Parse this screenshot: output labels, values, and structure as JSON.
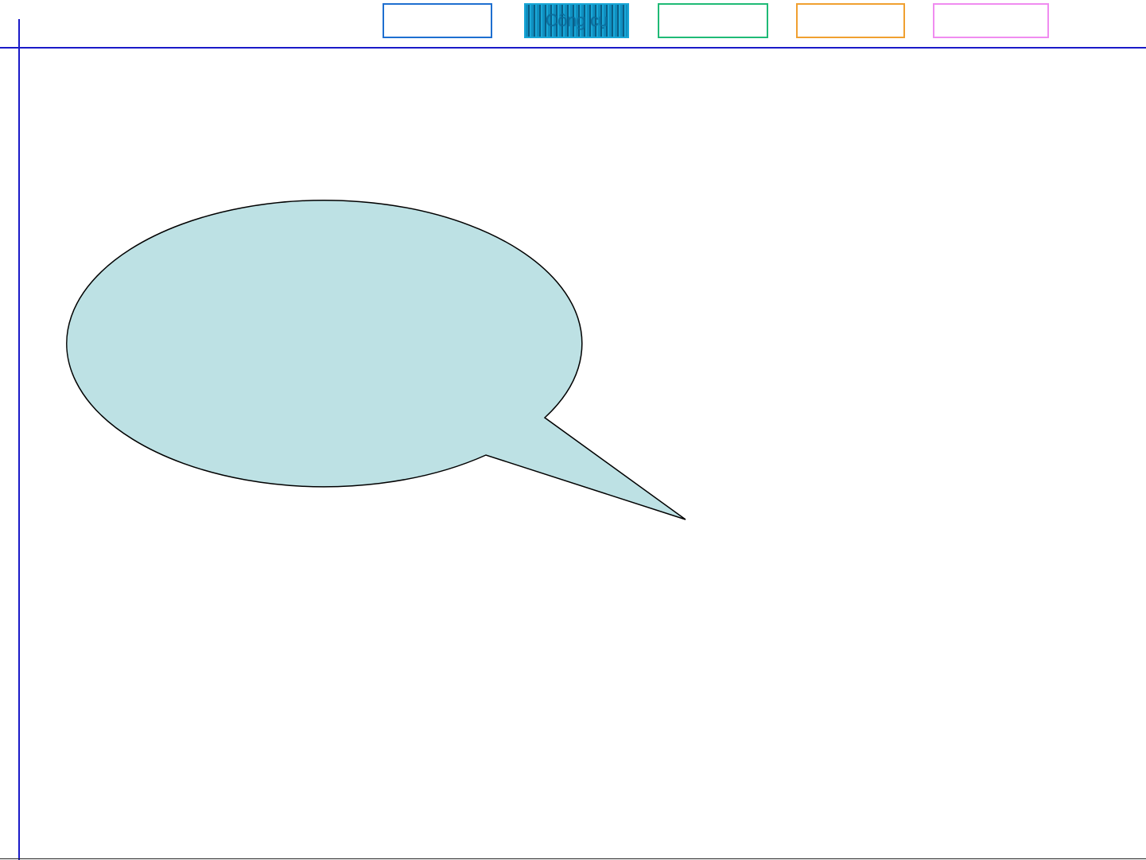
{
  "nav": {
    "buttons": [
      {
        "label": "",
        "border_color": "#1e6fd0"
      },
      {
        "label": "Công cụ",
        "border_color": "#18a6d6",
        "active": true
      },
      {
        "label": "",
        "border_color": "#1fba76"
      },
      {
        "label": "",
        "border_color": "#f0a030"
      },
      {
        "label": "",
        "border_color": "#f08cf0"
      }
    ]
  },
  "canvas": {
    "guide_line_color": "#1a1ac8",
    "callout": {
      "shape": "speech-bubble",
      "fill": "#bde1e4",
      "stroke": "#000000",
      "text": ""
    }
  }
}
